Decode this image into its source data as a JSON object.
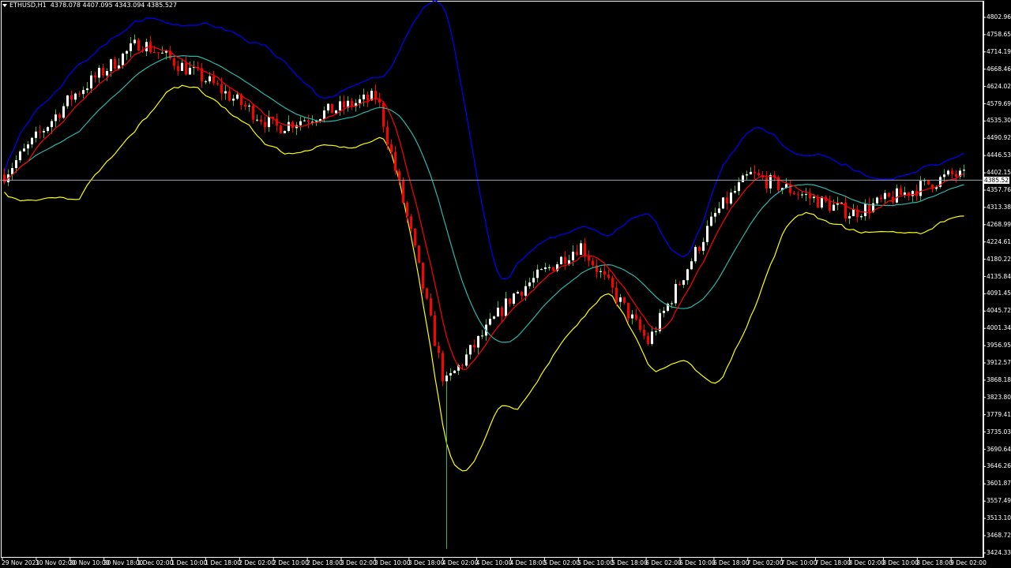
{
  "header": {
    "symbol_label": "ETHUSD,H1",
    "ohlc_text": "4378.078 4407.095 4343.094 4385.527"
  },
  "colors": {
    "background": "#000000",
    "axis": "#ffffff",
    "bull_candle": "#ffffff",
    "bull_wick": "#3cb83c",
    "bear_candle": "#ff0000",
    "upper_band": "#0000ff",
    "middle_band": "#2ab7a9",
    "lower_band": "#ffff00",
    "fast_ma": "#ff0000",
    "current_price_line": "#9aa6b2"
  },
  "price_axis": {
    "labels": [
      "4802.960",
      "4758.655",
      "4714.190",
      "4668.460",
      "4624.020",
      "4579.690",
      "4535.305",
      "4490.920",
      "4446.535",
      "4402.150",
      "4357.765",
      "4313.380",
      "4268.995",
      "4224.610",
      "4180.225",
      "4135.840",
      "4091.455",
      "4045.725",
      "4001.340",
      "3956.955",
      "3912.570",
      "3868.185",
      "3823.800",
      "3779.415",
      "3735.030",
      "3690.645",
      "3646.260",
      "3601.875",
      "3557.490",
      "3513.105",
      "3468.720",
      "3424.335"
    ],
    "current_price": "4385.527",
    "current_price_value": 4385.527
  },
  "time_axis": {
    "labels": [
      "29 Nov 2021",
      "30 Nov 02:00",
      "30 Nov 10:00",
      "30 Nov 18:00",
      "1 Dec 02:00",
      "1 Dec 10:00",
      "1 Dec 18:00",
      "2 Dec 02:00",
      "2 Dec 10:00",
      "2 Dec 18:00",
      "3 Dec 02:00",
      "3 Dec 10:00",
      "3 Dec 18:00",
      "4 Dec 02:00",
      "4 Dec 10:00",
      "4 Dec 18:00",
      "5 Dec 02:00",
      "5 Dec 10:00",
      "5 Dec 18:00",
      "6 Dec 02:00",
      "6 Dec 10:00",
      "6 Dec 18:00",
      "7 Dec 02:00",
      "7 Dec 10:00",
      "7 Dec 18:00",
      "8 Dec 02:00",
      "8 Dec 10:00",
      "8 Dec 18:00",
      "9 Dec 02:00"
    ]
  },
  "chart_data": {
    "type": "candlestick",
    "symbol": "ETHUSD",
    "timeframe": "H1",
    "ylim": [
      3424.335,
      4802.96
    ],
    "key_points": [
      {
        "time": "29 Nov 2021",
        "price": 4400
      },
      {
        "time": "30 Nov 10:00",
        "price": 4600
      },
      {
        "time": "1 Dec 02:00",
        "price": 4740
      },
      {
        "time": "1 Dec 18:00",
        "price": 4640
      },
      {
        "time": "2 Dec 10:00",
        "price": 4520
      },
      {
        "time": "3 Dec 10:00",
        "price": 4600
      },
      {
        "time": "3 Dec 18:00",
        "price": 4250
      },
      {
        "time": "4 Dec 02:00",
        "price": 3860,
        "low": 3440
      },
      {
        "time": "4 Dec 18:00",
        "price": 4090
      },
      {
        "time": "5 Dec 10:00",
        "price": 4220
      },
      {
        "time": "6 Dec 02:00",
        "price": 3970
      },
      {
        "time": "6 Dec 18:00",
        "price": 4300
      },
      {
        "time": "7 Dec 02:00",
        "price": 4400
      },
      {
        "time": "8 Dec 02:00",
        "price": 4300
      },
      {
        "time": "9 Dec 02:00",
        "price": 4400
      },
      {
        "time": "9 Dec 06:00",
        "price": 4385.527
      }
    ]
  }
}
